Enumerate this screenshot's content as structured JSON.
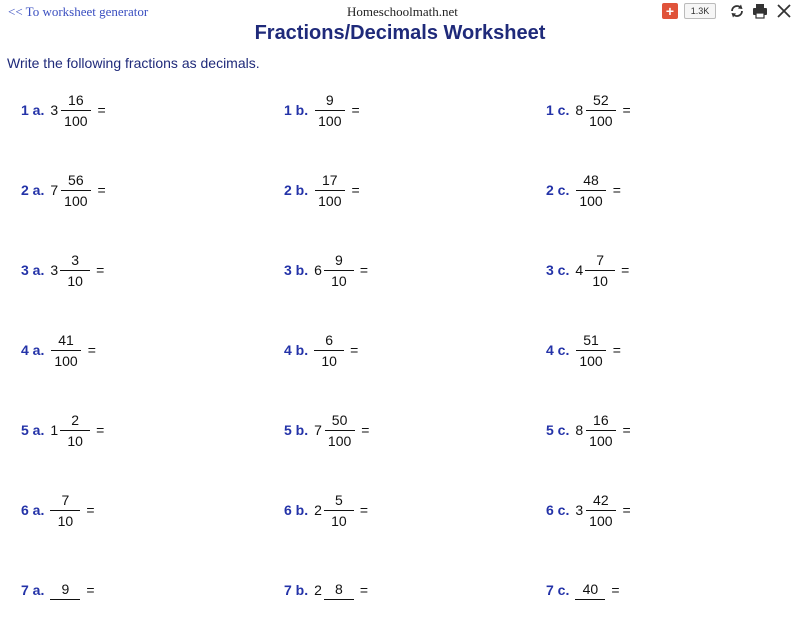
{
  "topbar": {
    "back_link": "<< To worksheet generator",
    "site_name": "Homeschoolmath.net",
    "plus_label": "+",
    "share_count": "1.3K",
    "icons": [
      "refresh-icon",
      "print-icon",
      "close-icon"
    ]
  },
  "title": "Fractions/Decimals Worksheet",
  "instructions": "Write the following fractions as decimals.",
  "rows": [
    [
      {
        "label": "1 a.",
        "whole": "3",
        "num": "16",
        "den": "100",
        "eq": "="
      },
      {
        "label": "1 b.",
        "whole": "",
        "num": "9",
        "den": "100",
        "eq": "="
      },
      {
        "label": "1 c.",
        "whole": "8",
        "num": "52",
        "den": "100",
        "eq": "="
      }
    ],
    [
      {
        "label": "2 a.",
        "whole": "7",
        "num": "56",
        "den": "100",
        "eq": "="
      },
      {
        "label": "2 b.",
        "whole": "",
        "num": "17",
        "den": "100",
        "eq": "="
      },
      {
        "label": "2 c.",
        "whole": "",
        "num": "48",
        "den": "100",
        "eq": "="
      }
    ],
    [
      {
        "label": "3 a.",
        "whole": "3",
        "num": "3",
        "den": "10",
        "eq": "="
      },
      {
        "label": "3 b.",
        "whole": "6",
        "num": "9",
        "den": "10",
        "eq": "="
      },
      {
        "label": "3 c.",
        "whole": "4",
        "num": "7",
        "den": "10",
        "eq": "="
      }
    ],
    [
      {
        "label": "4 a.",
        "whole": "",
        "num": "41",
        "den": "100",
        "eq": "="
      },
      {
        "label": "4 b.",
        "whole": "",
        "num": "6",
        "den": "10",
        "eq": "="
      },
      {
        "label": "4 c.",
        "whole": "",
        "num": "51",
        "den": "100",
        "eq": "="
      }
    ],
    [
      {
        "label": "5 a.",
        "whole": "1",
        "num": "2",
        "den": "10",
        "eq": "="
      },
      {
        "label": "5 b.",
        "whole": "7",
        "num": "50",
        "den": "100",
        "eq": "="
      },
      {
        "label": "5 c.",
        "whole": "8",
        "num": "16",
        "den": "100",
        "eq": "="
      }
    ],
    [
      {
        "label": "6 a.",
        "whole": "",
        "num": "7",
        "den": "10",
        "eq": "="
      },
      {
        "label": "6 b.",
        "whole": "2",
        "num": "5",
        "den": "10",
        "eq": "="
      },
      {
        "label": "6 c.",
        "whole": "3",
        "num": "42",
        "den": "100",
        "eq": "="
      }
    ],
    [
      {
        "label": "7 a.",
        "whole": "",
        "num": "9",
        "den": "",
        "eq": "="
      },
      {
        "label": "7 b.",
        "whole": "2",
        "num": "8",
        "den": "",
        "eq": "="
      },
      {
        "label": "7 c.",
        "whole": "",
        "num": "40",
        "den": "",
        "eq": "="
      }
    ]
  ]
}
